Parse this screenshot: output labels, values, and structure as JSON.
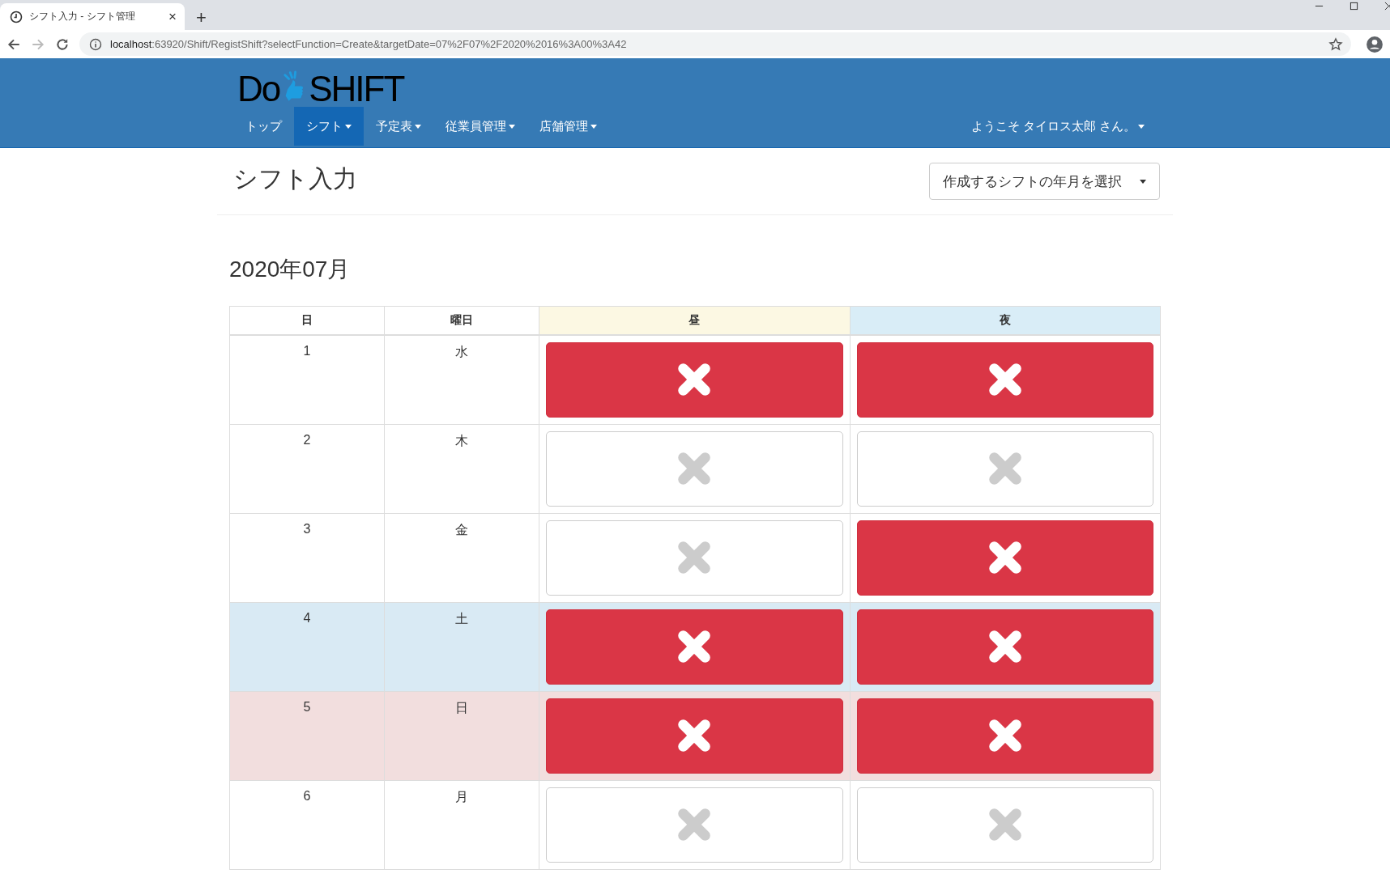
{
  "browser": {
    "tab_title": "シフト入力 - シフト管理",
    "tab_close": "×",
    "new_tab": "+",
    "url_host": "localhost",
    "url_rest": ":63920/Shift/RegistShift?selectFunction=Create&targetDate=07%2F07%2F2020%2016%3A00%3A42"
  },
  "navbar": {
    "logo_left": "Do",
    "logo_right": "SHIFT",
    "items": [
      {
        "label": "トップ",
        "selected": false,
        "dropdown": false
      },
      {
        "label": "シフト",
        "selected": true,
        "dropdown": true
      },
      {
        "label": "予定表",
        "selected": false,
        "dropdown": true
      },
      {
        "label": "従業員管理",
        "selected": false,
        "dropdown": true
      },
      {
        "label": "店舗管理",
        "selected": false,
        "dropdown": true
      }
    ],
    "user": "ようこそ タイロス太郎 さん。"
  },
  "page": {
    "title": "シフト入力",
    "month_picker": "作成するシフトの年月を選択",
    "month": "2020年07月"
  },
  "table": {
    "columns": [
      {
        "label": "日",
        "kind": "plain"
      },
      {
        "label": "曜日",
        "kind": "plain"
      },
      {
        "label": "昼",
        "kind": "day"
      },
      {
        "label": "夜",
        "kind": "night"
      }
    ],
    "rows": [
      {
        "day": "1",
        "weekday": "水",
        "kind": "weekday",
        "day_shift": {
          "on": true
        },
        "night_shift": {
          "on": true
        }
      },
      {
        "day": "2",
        "weekday": "木",
        "kind": "weekday",
        "day_shift": {
          "on": false
        },
        "night_shift": {
          "on": false
        }
      },
      {
        "day": "3",
        "weekday": "金",
        "kind": "weekday",
        "day_shift": {
          "on": false
        },
        "night_shift": {
          "on": true
        }
      },
      {
        "day": "4",
        "weekday": "土",
        "kind": "saturday",
        "day_shift": {
          "on": true
        },
        "night_shift": {
          "on": true
        }
      },
      {
        "day": "5",
        "weekday": "日",
        "kind": "sunday",
        "day_shift": {
          "on": true
        },
        "night_shift": {
          "on": true
        }
      },
      {
        "day": "6",
        "weekday": "月",
        "kind": "weekday",
        "day_shift": {
          "on": false
        },
        "night_shift": {
          "on": false
        }
      }
    ]
  }
}
